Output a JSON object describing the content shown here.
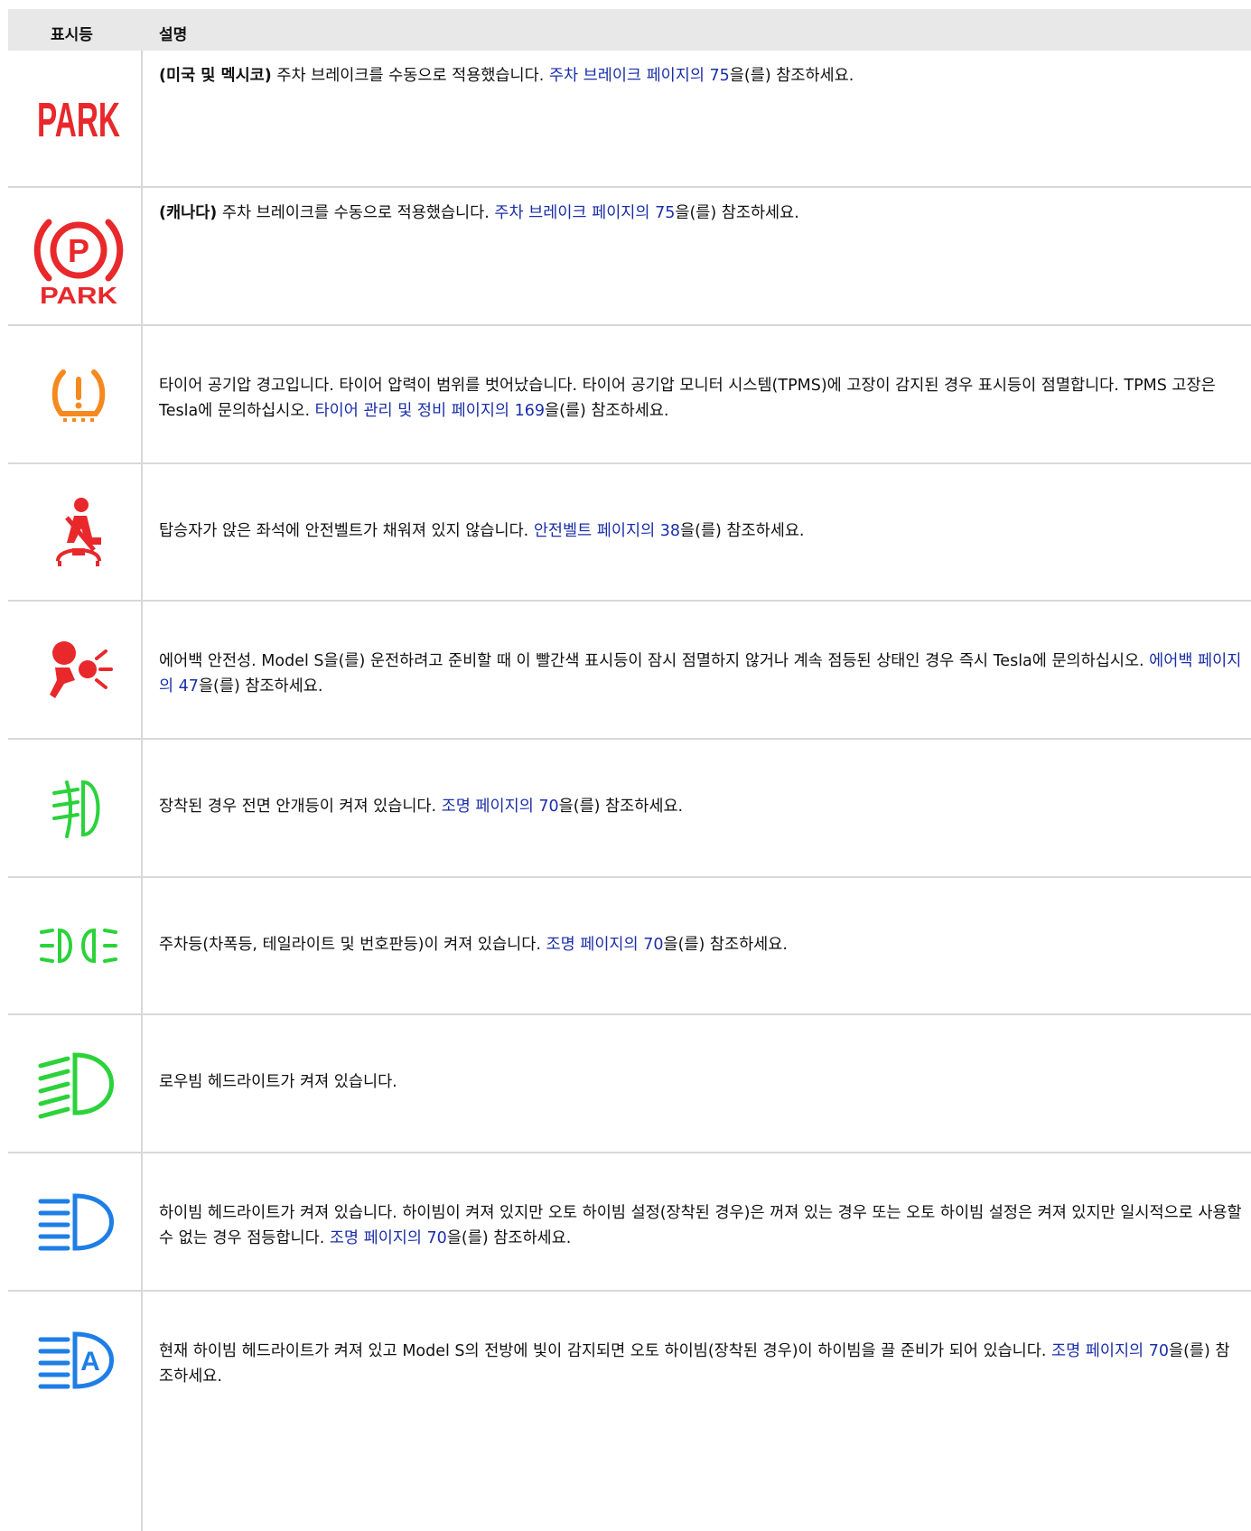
{
  "header": {
    "col_indicator": "표시등",
    "col_description": "설명"
  },
  "rows": [
    {
      "icon": "park-text-icon",
      "prefix_bold": "(미국 및 멕시코)",
      "text": " 주차 브레이크를 수동으로 적용했습니다. ",
      "link": "주차 브레이크 페이지의 75",
      "suffix": "을(를) 참조하세요."
    },
    {
      "icon": "park-brake-circle-icon",
      "prefix_bold": "(캐나다)",
      "text": " 주차 브레이크를 수동으로 적용했습니다. ",
      "link": "주차 브레이크 페이지의 75",
      "suffix": "을(를) 참조하세요."
    },
    {
      "icon": "tire-pressure-icon",
      "text": "타이어 공기압 경고입니다. 타이어 압력이 범위를 벗어났습니다. 타이어 공기압 모니터 시스템(TPMS)에 고장이 감지된 경우 표시등이 점멸합니다. TPMS 고장은 Tesla에 문의하십시오. ",
      "link": "타이어 관리 및 정비 페이지의 169",
      "suffix": "을(를) 참조하세요."
    },
    {
      "icon": "seatbelt-icon",
      "text": "탑승자가 앉은 좌석에 안전벨트가 채워져 있지 않습니다. ",
      "link": "안전벨트 페이지의 38",
      "suffix": "을(를) 참조하세요."
    },
    {
      "icon": "airbag-icon",
      "text": "에어백 안전성. Model S을(를) 운전하려고 준비할 때 이 빨간색 표시등이 잠시 점멸하지 않거나 계속 점등된 상태인 경우 즉시 Tesla에 문의하십시오. ",
      "link": "에어백 페이지의 47",
      "suffix": "을(를) 참조하세요."
    },
    {
      "icon": "front-fog-light-icon",
      "text": "장착된 경우 전면 안개등이 켜져 있습니다. ",
      "link": "조명 페이지의 70",
      "suffix": "을(를) 참조하세요."
    },
    {
      "icon": "parking-lights-icon",
      "text": "주차등(차폭등, 테일라이트 및 번호판등)이 켜져 있습니다. ",
      "link": "조명 페이지의 70",
      "suffix": "을(를) 참조하세요."
    },
    {
      "icon": "low-beam-icon",
      "text": "로우빔 헤드라이트가 켜져 있습니다.",
      "link": "",
      "suffix": ""
    },
    {
      "icon": "high-beam-icon",
      "text": "하이빔 헤드라이트가 켜져 있습니다. 하이빔이 켜져 있지만 오토 하이빔 설정(장착된 경우)은 꺼져 있는 경우 또는 오토 하이빔 설정은 켜져 있지만 일시적으로 사용할 수 없는 경우 점등합니다. ",
      "link": "조명 페이지의 70",
      "suffix": "을(를) 참조하세요."
    },
    {
      "icon": "auto-high-beam-icon",
      "text": "현재 하이빔 헤드라이트가 켜져 있고 Model S의 전방에 빛이 감지되면 오토 하이빔(장착된 경우)이 하이빔을 끌 준비가 되어 있습니다. ",
      "link": "조명 페이지의 70",
      "suffix": "을(를) 참조하세요."
    }
  ],
  "icon_text": {
    "park": "PARK",
    "park_small": "PARK",
    "p_letter": "P",
    "a_letter": "A"
  },
  "colors": {
    "red": "#e8282b",
    "orange": "#f5891f",
    "green": "#2bd23a",
    "blue": "#1e7ee6",
    "link": "#1a2ea8"
  }
}
